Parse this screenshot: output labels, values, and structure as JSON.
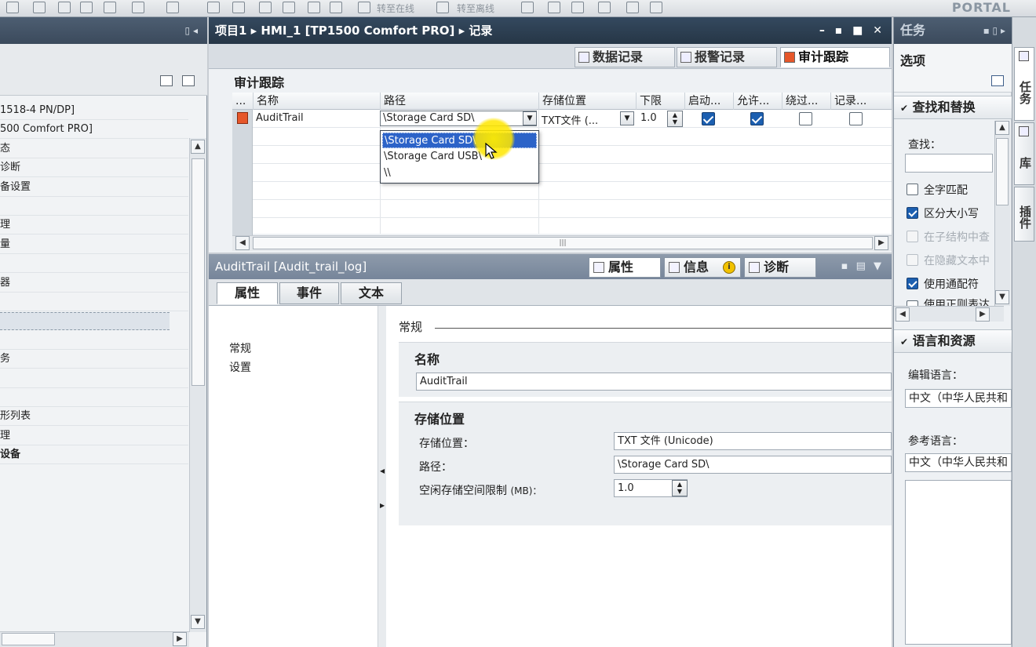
{
  "toolbar": {
    "go_online": "转至在线",
    "go_offline": "转至离线",
    "portal": "PORTAL"
  },
  "left_tree": {
    "items": [
      {
        "text": "1518-4 PN/DP]",
        "bold": false
      },
      {
        "text": "500 Comfort PRO]",
        "bold": false
      },
      {
        "text": "态",
        "bold": false
      },
      {
        "text": "诊断",
        "bold": false
      },
      {
        "text": "备设置",
        "bold": false
      },
      {
        "text": "",
        "bold": false
      },
      {
        "text": "理",
        "bold": false
      },
      {
        "text": "量",
        "bold": false
      },
      {
        "text": "",
        "bold": false
      },
      {
        "text": "器",
        "bold": false
      },
      {
        "text": "",
        "bold": false
      },
      {
        "text": "",
        "bold": false,
        "selected": true
      },
      {
        "text": "",
        "bold": false
      },
      {
        "text": "务",
        "bold": false
      },
      {
        "text": "",
        "bold": false
      },
      {
        "text": "",
        "bold": false
      },
      {
        "text": "形列表",
        "bold": false
      },
      {
        "text": "理",
        "bold": false
      },
      {
        "text": "设备",
        "bold": true
      }
    ]
  },
  "editor": {
    "breadcrumb": "项目1 ▸ HMI_1 [TP1500 Comfort PRO] ▸ 记录",
    "tabs": [
      {
        "label": "数据记录",
        "active": false
      },
      {
        "label": "报警记录",
        "active": false
      },
      {
        "label": "审计跟踪",
        "active": true
      }
    ],
    "grid_title": "审计跟踪",
    "columns": [
      "...",
      "名称",
      "路径",
      "存储位置",
      "下限",
      "启动...",
      "允许...",
      "绕过...",
      "记录..."
    ],
    "rows": [
      {
        "name": "AuditTrail",
        "path": "\\Storage Card SD\\",
        "storage": "TXT文件 (...",
        "lower_limit": "1.0",
        "start": true,
        "allow": true,
        "bypass": false,
        "log": false
      }
    ],
    "path_options": [
      "\\Storage Card SD\\",
      "\\Storage Card USB\\",
      "\\\\"
    ],
    "path_selected_index": 0
  },
  "inspector": {
    "title": "AuditTrail [Audit_trail_log]",
    "tabs": [
      {
        "label": "属性",
        "active": true
      },
      {
        "label": "信息",
        "active": false
      },
      {
        "label": "诊断",
        "active": false
      }
    ],
    "subtabs": [
      {
        "label": "属性",
        "active": true
      },
      {
        "label": "事件",
        "active": false
      },
      {
        "label": "文本",
        "active": false
      }
    ],
    "nav": [
      "常规",
      "设置"
    ],
    "group_heading": "常规",
    "name_section": {
      "title": "名称",
      "value": "AuditTrail"
    },
    "storage_section": {
      "title": "存储位置",
      "storage_label": "存储位置：",
      "storage_value": "TXT 文件 (Unicode)",
      "path_label": "路径：",
      "path_value": "\\Storage Card SD\\",
      "free_space_label": "空闲存储空间限制",
      "free_space_unit": "(MB)：",
      "free_space_value": "1.0"
    }
  },
  "task_pane": {
    "title": "任务",
    "options_label": "选项",
    "find_replace": {
      "heading": "查找和替换",
      "find_label": "查找：",
      "find_value": "",
      "options": [
        {
          "label": "全字匹配",
          "checked": false,
          "disabled": false
        },
        {
          "label": "区分大小写",
          "checked": true,
          "disabled": false
        },
        {
          "label": "在子结构中查",
          "checked": false,
          "disabled": true
        },
        {
          "label": "在隐藏文本中",
          "checked": false,
          "disabled": true
        },
        {
          "label": "使用通配符",
          "checked": true,
          "disabled": false
        },
        {
          "label": "使用正则表达",
          "checked": false,
          "disabled": false
        }
      ]
    },
    "languages": {
      "heading": "语言和资源",
      "edit_label": "编辑语言：",
      "edit_value": "中文（中华人民共和",
      "ref_label": "参考语言：",
      "ref_value": "中文（中华人民共和"
    }
  },
  "side_tabs": [
    "任务",
    "库",
    "插件"
  ]
}
